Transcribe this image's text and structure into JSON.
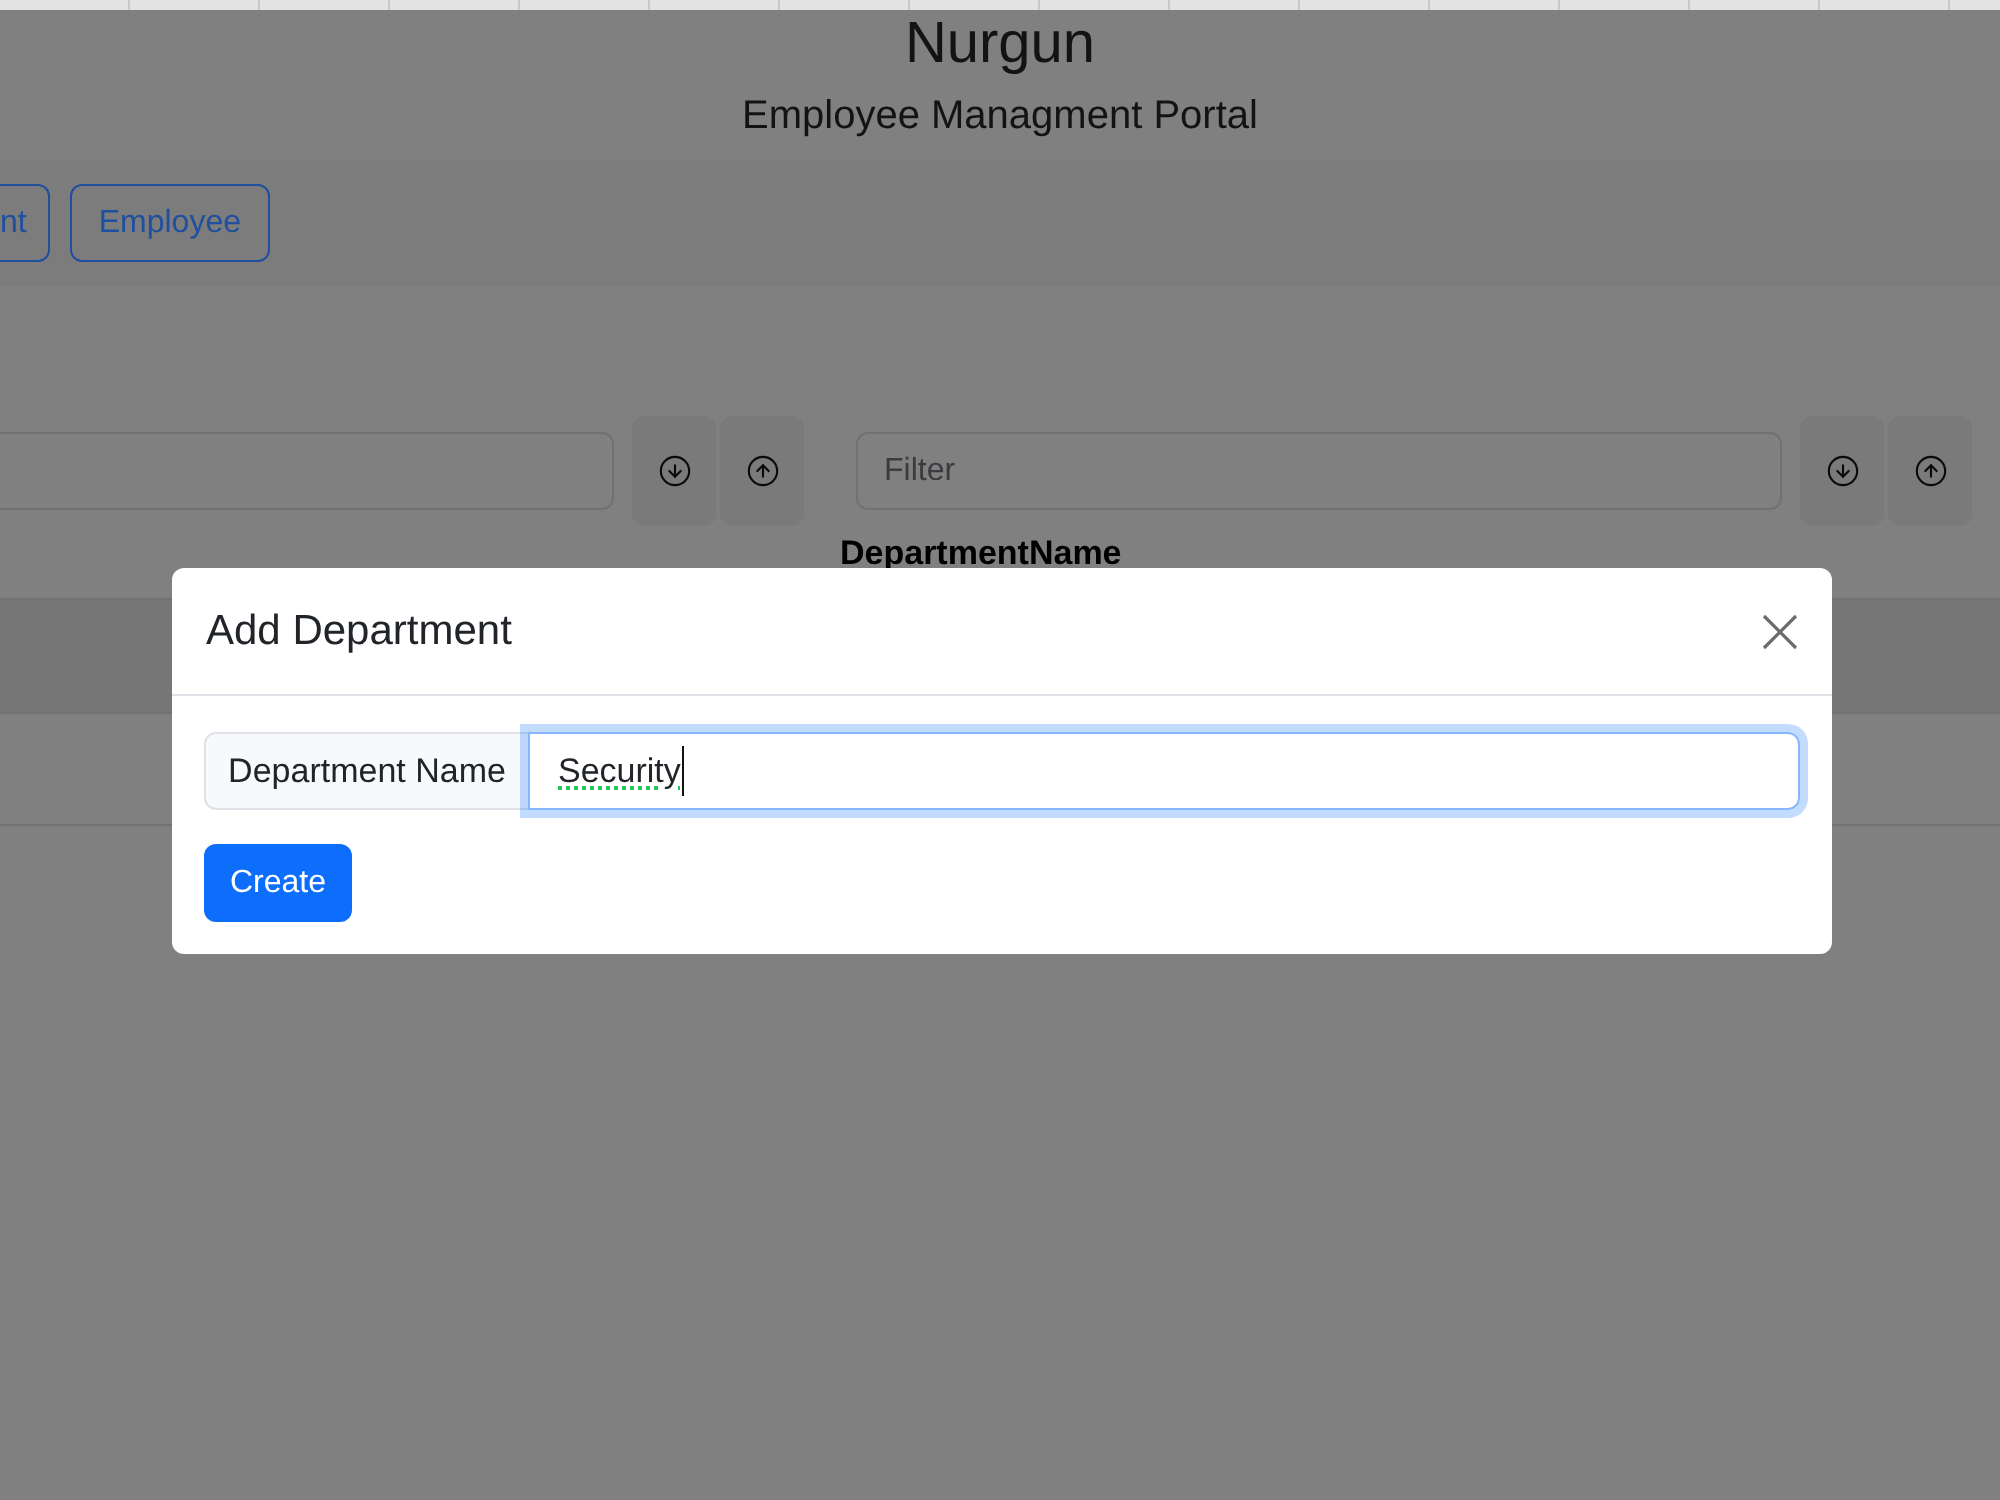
{
  "page": {
    "title": "Nurgun",
    "subtitle": "Employee Managment Portal"
  },
  "nav": {
    "buttons": [
      {
        "label": "nt"
      },
      {
        "label": "Employee"
      }
    ]
  },
  "filter_fields": [
    {
      "sort_buttons": [
        {
          "kind": "descending"
        },
        {
          "kind": "ascending"
        }
      ]
    },
    {
      "placeholder": "Filter",
      "sort_buttons": [
        {
          "kind": "descending"
        },
        {
          "kind": "ascending"
        }
      ]
    }
  ],
  "table": {
    "header": "DepartmentName"
  },
  "modal": {
    "title": "Add Department",
    "field": {
      "label": "Department Name",
      "value": "Security",
      "spellcheck_flagged": true,
      "focused": true
    },
    "buttons": [
      {
        "label": "Create"
      }
    ]
  }
}
